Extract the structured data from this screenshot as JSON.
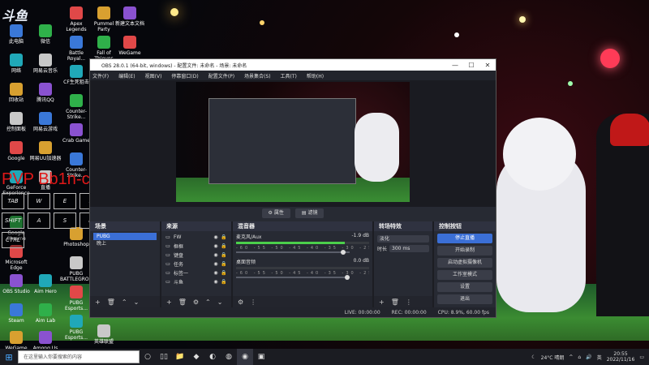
{
  "desktop": {
    "watermark": "斗鱼",
    "overlay_name": "PVP Bb1n-cxh",
    "icons": [
      {
        "label": "此电脑",
        "x": "col0"
      },
      {
        "label": "微信",
        "x": "col1"
      },
      {
        "label": "Apex Legends",
        "x": "col2"
      },
      {
        "label": "Pummel Party",
        "x": "col3"
      },
      {
        "label": "新建文本文档",
        "x": "col4"
      },
      {
        "label": "网络",
        "x": "col0"
      },
      {
        "label": "网易云音乐",
        "x": "col1"
      },
      {
        "label": "Battle Royal...",
        "x": "col2"
      },
      {
        "label": "Fall of Thieves",
        "x": "col3"
      },
      {
        "label": "WeGame",
        "x": "col4"
      },
      {
        "label": "回收站",
        "x": "col0"
      },
      {
        "label": "腾讯QQ",
        "x": "col1"
      },
      {
        "label": "CF生死狙击",
        "x": "col2"
      },
      {
        "label": "控制面板",
        "x": "col0"
      },
      {
        "label": "网易云游戏",
        "x": "col1"
      },
      {
        "label": "Counter-Strike...",
        "x": "col2"
      },
      {
        "label": "Google",
        "x": "col0"
      },
      {
        "label": "网易UU加速器",
        "x": "col1"
      },
      {
        "label": "Crab Game",
        "x": "col2"
      },
      {
        "label": "GeForce Experience",
        "x": "col0"
      },
      {
        "label": "直播",
        "x": "col1"
      },
      {
        "label": "Counter-Strike...",
        "x": "col2"
      },
      {
        "label": "Google Chrome",
        "x": "col0"
      },
      {
        "label": "Microsoft Edge",
        "x": "col0"
      },
      {
        "label": "Photoshop",
        "x": "col2"
      },
      {
        "label": "OBS Studio",
        "x": "col0"
      },
      {
        "label": "Aim Hero",
        "x": "col1"
      },
      {
        "label": "PUBG BATTLEGROUNDS",
        "x": "col2"
      },
      {
        "label": "Steam",
        "x": "col0"
      },
      {
        "label": "Aim Lab",
        "x": "col1"
      },
      {
        "label": "PUBG Esports...",
        "x": "col2"
      },
      {
        "label": "WeGame",
        "x": "col0"
      },
      {
        "label": "Among Us",
        "x": "col1"
      },
      {
        "label": "PUBG Esports...",
        "x": "col2"
      },
      {
        "label": "英雄联盟",
        "x": "col3"
      }
    ],
    "keys": [
      "TAB",
      "W",
      "E",
      "R",
      "SHIFT",
      "A",
      "S",
      "D",
      "CTRL"
    ]
  },
  "obs": {
    "title": "OBS 28.0.1 (64-bit, windows) - 配置文件: 未命名 - 场景: 未命名",
    "menu": [
      "文件(F)",
      "编辑(E)",
      "视图(V)",
      "停靠窗口(D)",
      "配置文件(P)",
      "场景集合(S)",
      "工具(T)",
      "帮助(H)"
    ],
    "preview_buttons": [
      "属性",
      "滤镜"
    ],
    "docks": {
      "scenes": {
        "title": "场景",
        "items": [
          "PUBG",
          "晚上"
        ],
        "active": 0
      },
      "sources": {
        "title": "来源",
        "items": [
          "FW",
          "框框",
          "键盘",
          "任务",
          "标签一",
          "斗鱼"
        ]
      },
      "mixer": {
        "title": "混音器",
        "scale": "-60 -55 -50 -45 -40 -35 -30 -25 -20 -15 -10 -5 0",
        "channels": [
          {
            "name": "麦克风/Aux",
            "db": "-1.9 dB",
            "level": 0.82,
            "volume": 0.96
          },
          {
            "name": "桌面音频",
            "db": "0.0 dB",
            "level": 0.0,
            "volume": 1.0
          }
        ]
      },
      "transitions": {
        "title": "转场特效",
        "type": "淡化",
        "duration_label": "时长",
        "duration": "300 ms"
      },
      "controls": {
        "title": "控制按钮",
        "buttons": [
          "停止直播",
          "开始录制",
          "启动虚拟摄像机",
          "工作室模式",
          "设置",
          "退出"
        ]
      }
    },
    "status": {
      "live": "LIVE: 00:00:00",
      "rec": "REC: 00:00:00",
      "cpu": "CPU: 8.9%, 60.00 fps"
    }
  },
  "taskbar": {
    "search_placeholder": "在这里输入你要搜索的内容",
    "weather": "24°C 晴朗",
    "time": "20:55",
    "date": "2022/11/16"
  }
}
